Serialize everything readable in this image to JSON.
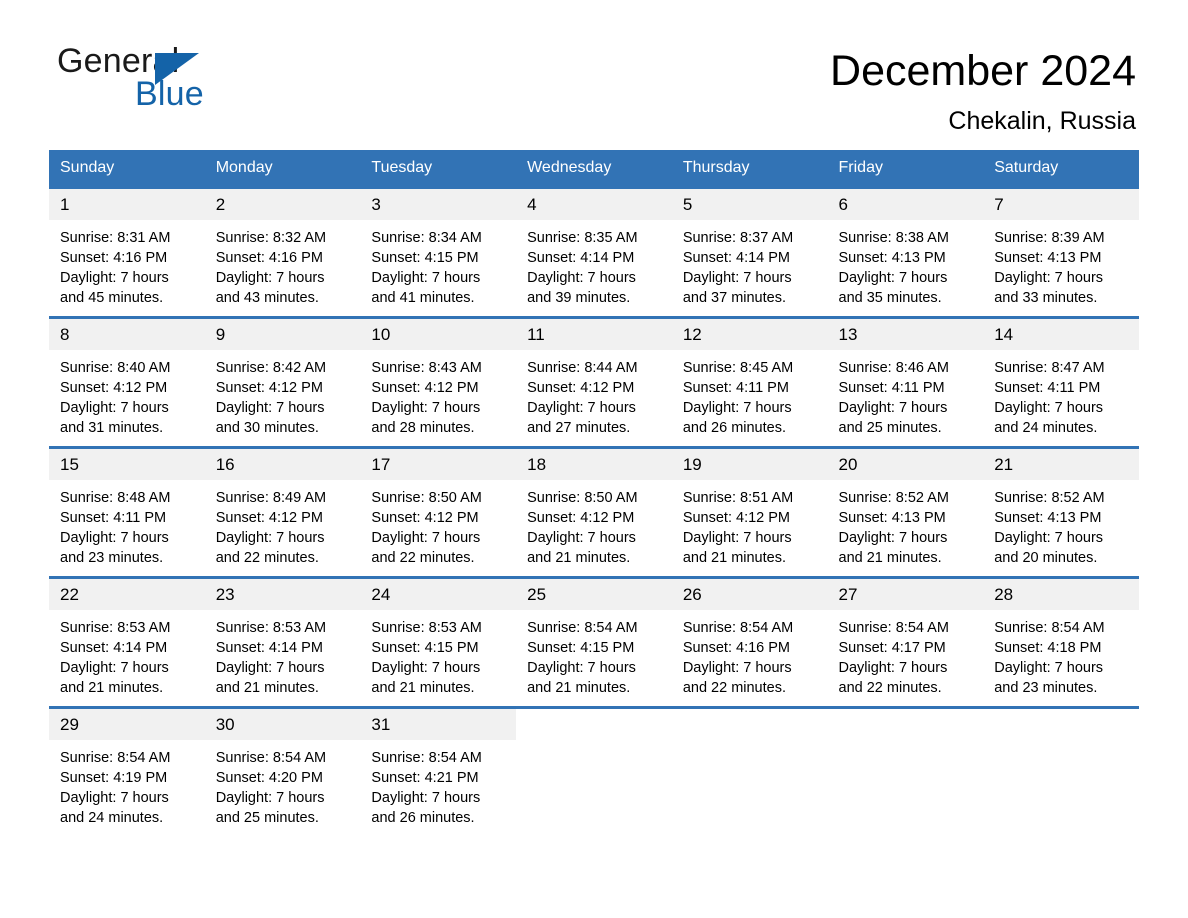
{
  "brand": {
    "name_dark": "General",
    "name_light": "Blue",
    "accent_color": "#1463a8",
    "logo_icon": "triangle-flag-icon"
  },
  "header": {
    "month_title": "December 2024",
    "location": "Chekalin, Russia",
    "header_bg_color": "#3273b5",
    "daynum_bg_color": "#f1f1f1"
  },
  "weekday_headers": [
    "Sunday",
    "Monday",
    "Tuesday",
    "Wednesday",
    "Thursday",
    "Friday",
    "Saturday"
  ],
  "weeks": [
    [
      {
        "day": "1",
        "sunrise": "Sunrise: 8:31 AM",
        "sunset": "Sunset: 4:16 PM",
        "daylight_line1": "Daylight: 7 hours",
        "daylight_line2": "and 45 minutes."
      },
      {
        "day": "2",
        "sunrise": "Sunrise: 8:32 AM",
        "sunset": "Sunset: 4:16 PM",
        "daylight_line1": "Daylight: 7 hours",
        "daylight_line2": "and 43 minutes."
      },
      {
        "day": "3",
        "sunrise": "Sunrise: 8:34 AM",
        "sunset": "Sunset: 4:15 PM",
        "daylight_line1": "Daylight: 7 hours",
        "daylight_line2": "and 41 minutes."
      },
      {
        "day": "4",
        "sunrise": "Sunrise: 8:35 AM",
        "sunset": "Sunset: 4:14 PM",
        "daylight_line1": "Daylight: 7 hours",
        "daylight_line2": "and 39 minutes."
      },
      {
        "day": "5",
        "sunrise": "Sunrise: 8:37 AM",
        "sunset": "Sunset: 4:14 PM",
        "daylight_line1": "Daylight: 7 hours",
        "daylight_line2": "and 37 minutes."
      },
      {
        "day": "6",
        "sunrise": "Sunrise: 8:38 AM",
        "sunset": "Sunset: 4:13 PM",
        "daylight_line1": "Daylight: 7 hours",
        "daylight_line2": "and 35 minutes."
      },
      {
        "day": "7",
        "sunrise": "Sunrise: 8:39 AM",
        "sunset": "Sunset: 4:13 PM",
        "daylight_line1": "Daylight: 7 hours",
        "daylight_line2": "and 33 minutes."
      }
    ],
    [
      {
        "day": "8",
        "sunrise": "Sunrise: 8:40 AM",
        "sunset": "Sunset: 4:12 PM",
        "daylight_line1": "Daylight: 7 hours",
        "daylight_line2": "and 31 minutes."
      },
      {
        "day": "9",
        "sunrise": "Sunrise: 8:42 AM",
        "sunset": "Sunset: 4:12 PM",
        "daylight_line1": "Daylight: 7 hours",
        "daylight_line2": "and 30 minutes."
      },
      {
        "day": "10",
        "sunrise": "Sunrise: 8:43 AM",
        "sunset": "Sunset: 4:12 PM",
        "daylight_line1": "Daylight: 7 hours",
        "daylight_line2": "and 28 minutes."
      },
      {
        "day": "11",
        "sunrise": "Sunrise: 8:44 AM",
        "sunset": "Sunset: 4:12 PM",
        "daylight_line1": "Daylight: 7 hours",
        "daylight_line2": "and 27 minutes."
      },
      {
        "day": "12",
        "sunrise": "Sunrise: 8:45 AM",
        "sunset": "Sunset: 4:11 PM",
        "daylight_line1": "Daylight: 7 hours",
        "daylight_line2": "and 26 minutes."
      },
      {
        "day": "13",
        "sunrise": "Sunrise: 8:46 AM",
        "sunset": "Sunset: 4:11 PM",
        "daylight_line1": "Daylight: 7 hours",
        "daylight_line2": "and 25 minutes."
      },
      {
        "day": "14",
        "sunrise": "Sunrise: 8:47 AM",
        "sunset": "Sunset: 4:11 PM",
        "daylight_line1": "Daylight: 7 hours",
        "daylight_line2": "and 24 minutes."
      }
    ],
    [
      {
        "day": "15",
        "sunrise": "Sunrise: 8:48 AM",
        "sunset": "Sunset: 4:11 PM",
        "daylight_line1": "Daylight: 7 hours",
        "daylight_line2": "and 23 minutes."
      },
      {
        "day": "16",
        "sunrise": "Sunrise: 8:49 AM",
        "sunset": "Sunset: 4:12 PM",
        "daylight_line1": "Daylight: 7 hours",
        "daylight_line2": "and 22 minutes."
      },
      {
        "day": "17",
        "sunrise": "Sunrise: 8:50 AM",
        "sunset": "Sunset: 4:12 PM",
        "daylight_line1": "Daylight: 7 hours",
        "daylight_line2": "and 22 minutes."
      },
      {
        "day": "18",
        "sunrise": "Sunrise: 8:50 AM",
        "sunset": "Sunset: 4:12 PM",
        "daylight_line1": "Daylight: 7 hours",
        "daylight_line2": "and 21 minutes."
      },
      {
        "day": "19",
        "sunrise": "Sunrise: 8:51 AM",
        "sunset": "Sunset: 4:12 PM",
        "daylight_line1": "Daylight: 7 hours",
        "daylight_line2": "and 21 minutes."
      },
      {
        "day": "20",
        "sunrise": "Sunrise: 8:52 AM",
        "sunset": "Sunset: 4:13 PM",
        "daylight_line1": "Daylight: 7 hours",
        "daylight_line2": "and 21 minutes."
      },
      {
        "day": "21",
        "sunrise": "Sunrise: 8:52 AM",
        "sunset": "Sunset: 4:13 PM",
        "daylight_line1": "Daylight: 7 hours",
        "daylight_line2": "and 20 minutes."
      }
    ],
    [
      {
        "day": "22",
        "sunrise": "Sunrise: 8:53 AM",
        "sunset": "Sunset: 4:14 PM",
        "daylight_line1": "Daylight: 7 hours",
        "daylight_line2": "and 21 minutes."
      },
      {
        "day": "23",
        "sunrise": "Sunrise: 8:53 AM",
        "sunset": "Sunset: 4:14 PM",
        "daylight_line1": "Daylight: 7 hours",
        "daylight_line2": "and 21 minutes."
      },
      {
        "day": "24",
        "sunrise": "Sunrise: 8:53 AM",
        "sunset": "Sunset: 4:15 PM",
        "daylight_line1": "Daylight: 7 hours",
        "daylight_line2": "and 21 minutes."
      },
      {
        "day": "25",
        "sunrise": "Sunrise: 8:54 AM",
        "sunset": "Sunset: 4:15 PM",
        "daylight_line1": "Daylight: 7 hours",
        "daylight_line2": "and 21 minutes."
      },
      {
        "day": "26",
        "sunrise": "Sunrise: 8:54 AM",
        "sunset": "Sunset: 4:16 PM",
        "daylight_line1": "Daylight: 7 hours",
        "daylight_line2": "and 22 minutes."
      },
      {
        "day": "27",
        "sunrise": "Sunrise: 8:54 AM",
        "sunset": "Sunset: 4:17 PM",
        "daylight_line1": "Daylight: 7 hours",
        "daylight_line2": "and 22 minutes."
      },
      {
        "day": "28",
        "sunrise": "Sunrise: 8:54 AM",
        "sunset": "Sunset: 4:18 PM",
        "daylight_line1": "Daylight: 7 hours",
        "daylight_line2": "and 23 minutes."
      }
    ],
    [
      {
        "day": "29",
        "sunrise": "Sunrise: 8:54 AM",
        "sunset": "Sunset: 4:19 PM",
        "daylight_line1": "Daylight: 7 hours",
        "daylight_line2": "and 24 minutes."
      },
      {
        "day": "30",
        "sunrise": "Sunrise: 8:54 AM",
        "sunset": "Sunset: 4:20 PM",
        "daylight_line1": "Daylight: 7 hours",
        "daylight_line2": "and 25 minutes."
      },
      {
        "day": "31",
        "sunrise": "Sunrise: 8:54 AM",
        "sunset": "Sunset: 4:21 PM",
        "daylight_line1": "Daylight: 7 hours",
        "daylight_line2": "and 26 minutes."
      },
      {
        "day": "",
        "sunrise": "",
        "sunset": "",
        "daylight_line1": "",
        "daylight_line2": ""
      },
      {
        "day": "",
        "sunrise": "",
        "sunset": "",
        "daylight_line1": "",
        "daylight_line2": ""
      },
      {
        "day": "",
        "sunrise": "",
        "sunset": "",
        "daylight_line1": "",
        "daylight_line2": ""
      },
      {
        "day": "",
        "sunrise": "",
        "sunset": "",
        "daylight_line1": "",
        "daylight_line2": ""
      }
    ]
  ]
}
